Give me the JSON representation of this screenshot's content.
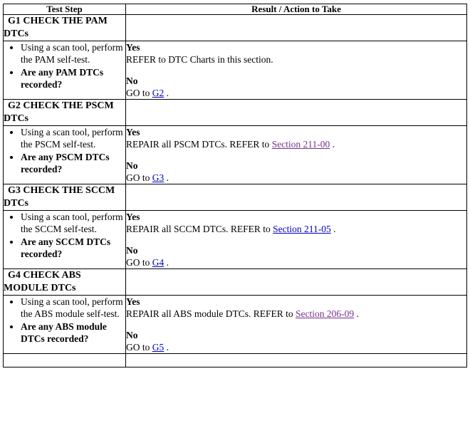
{
  "table": {
    "headers": {
      "step": "Test Step",
      "result": "Result / Action to Take"
    },
    "link_colors": {
      "unvisited": "#0000cc",
      "visited": "#7a2f8f"
    },
    "rows": [
      {
        "id": "G1",
        "title": "G1 CHECK THE PAM DTCs",
        "steps": [
          {
            "text": "Using a scan tool, perform the PAM self-test.",
            "bold": false
          },
          {
            "text": "Are any PAM DTCs recorded?",
            "bold": true
          }
        ],
        "results": [
          {
            "label": "Yes",
            "prefix": "REFER to DTC Charts in this section.",
            "link": "",
            "link_state": "",
            "suffix": ""
          },
          {
            "label": "No",
            "prefix": "GO to ",
            "link": "G2",
            "link_state": "unvisited",
            "suffix": " ."
          }
        ]
      },
      {
        "id": "G2",
        "title": "G2 CHECK THE PSCM DTCs",
        "steps": [
          {
            "text": "Using a scan tool, perform the PSCM self-test.",
            "bold": false
          },
          {
            "text": "Are any PSCM DTCs recorded?",
            "bold": true
          }
        ],
        "results": [
          {
            "label": "Yes",
            "prefix": "REPAIR all PSCM DTCs. REFER to ",
            "link": "Section 211-00",
            "link_state": "visited",
            "suffix": " ."
          },
          {
            "label": "No",
            "prefix": "GO to ",
            "link": "G3",
            "link_state": "unvisited",
            "suffix": " ."
          }
        ]
      },
      {
        "id": "G3",
        "title": "G3 CHECK THE SCCM DTCs",
        "steps": [
          {
            "text": "Using a scan tool, perform the SCCM self-test.",
            "bold": false
          },
          {
            "text": "Are any SCCM DTCs recorded?",
            "bold": true
          }
        ],
        "results": [
          {
            "label": "Yes",
            "prefix": "REPAIR all SCCM DTCs. REFER to ",
            "link": "Section 211-05",
            "link_state": "unvisited",
            "suffix": " ."
          },
          {
            "label": "No",
            "prefix": "GO to ",
            "link": "G4",
            "link_state": "unvisited",
            "suffix": " ."
          }
        ]
      },
      {
        "id": "G4",
        "title": "G4 CHECK ABS MODULE DTCs",
        "steps": [
          {
            "text": "Using a scan tool, perform the ABS module self-test.",
            "bold": false
          },
          {
            "text": "Are any ABS module DTCs recorded?",
            "bold": true
          }
        ],
        "results": [
          {
            "label": "Yes",
            "prefix": "REPAIR all ABS module DTCs. REFER to ",
            "link": "Section 206-09",
            "link_state": "visited",
            "suffix": " ."
          },
          {
            "label": "No",
            "prefix": "GO to ",
            "link": "G5",
            "link_state": "unvisited",
            "suffix": " ."
          }
        ]
      }
    ]
  }
}
